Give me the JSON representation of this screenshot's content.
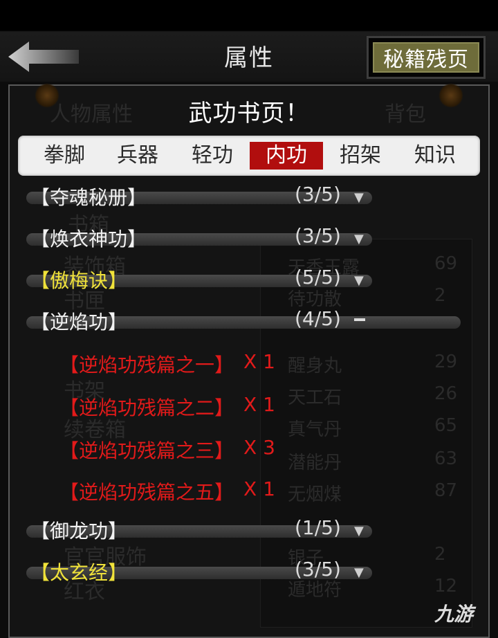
{
  "header": {
    "title": "属性",
    "secret_button": "秘籍残页"
  },
  "background_tabs": {
    "left": "人物属性",
    "right": "背包"
  },
  "background_list": {
    "left_items": [
      "书箱",
      "装饰箱",
      "书匣",
      "书架",
      "续卷箱",
      "官官服饰",
      "红衣"
    ],
    "right_items": [
      {
        "name": "天香玉露",
        "count": "69"
      },
      {
        "name": "待功散",
        "count": "2"
      },
      {
        "name": "醒身丸",
        "count": "29"
      },
      {
        "name": "天工石",
        "count": "26"
      },
      {
        "name": "真气丹",
        "count": "65"
      },
      {
        "name": "潜能丹",
        "count": "63"
      },
      {
        "name": "无烟煤",
        "count": "87"
      },
      {
        "name": "银子",
        "count": "2"
      },
      {
        "name": "遁地符",
        "count": "12"
      }
    ]
  },
  "page_title": "武功书页！",
  "tabs": [
    {
      "label": "拳脚",
      "active": false
    },
    {
      "label": "兵器",
      "active": false
    },
    {
      "label": "轻功",
      "active": false
    },
    {
      "label": "内功",
      "active": true
    },
    {
      "label": "招架",
      "active": false
    },
    {
      "label": "知识",
      "active": false
    }
  ],
  "books": [
    {
      "name": "【夺魂秘册】",
      "count": "(3/5)",
      "toggle": "expand-icon",
      "color": "#f2f2f2"
    },
    {
      "name": "【焕衣神功】",
      "count": "(3/5)",
      "toggle": "expand-icon",
      "color": "#f2f2f2"
    },
    {
      "name": "【傲梅诀】",
      "count": "(5/5)",
      "toggle": "expand-icon",
      "color": "#f0e23a"
    },
    {
      "name": "【逆焰功】",
      "count": "(4/5)",
      "toggle": "collapse-icon",
      "color": "#f2f2f2",
      "fragments": [
        {
          "name": "【逆焰功残篇之一】",
          "qty": "X 1"
        },
        {
          "name": "【逆焰功残篇之二】",
          "qty": "X 1"
        },
        {
          "name": "【逆焰功残篇之三】",
          "qty": "X 3"
        },
        {
          "name": "【逆焰功残篇之五】",
          "qty": "X 1"
        }
      ]
    },
    {
      "name": "【御龙功】",
      "count": "(1/5)",
      "toggle": "expand-icon",
      "color": "#f2f2f2"
    },
    {
      "name": "【太玄经】",
      "count": "(3/5)",
      "toggle": "expand-icon",
      "color": "#f0e23a"
    }
  ],
  "watermark": "九游",
  "colors": {
    "active_tab": "#b10e0e",
    "fragment_text": "#e21a1a",
    "gold_text": "#f0e23a",
    "secret_button_bg": "#6e6c3a"
  }
}
